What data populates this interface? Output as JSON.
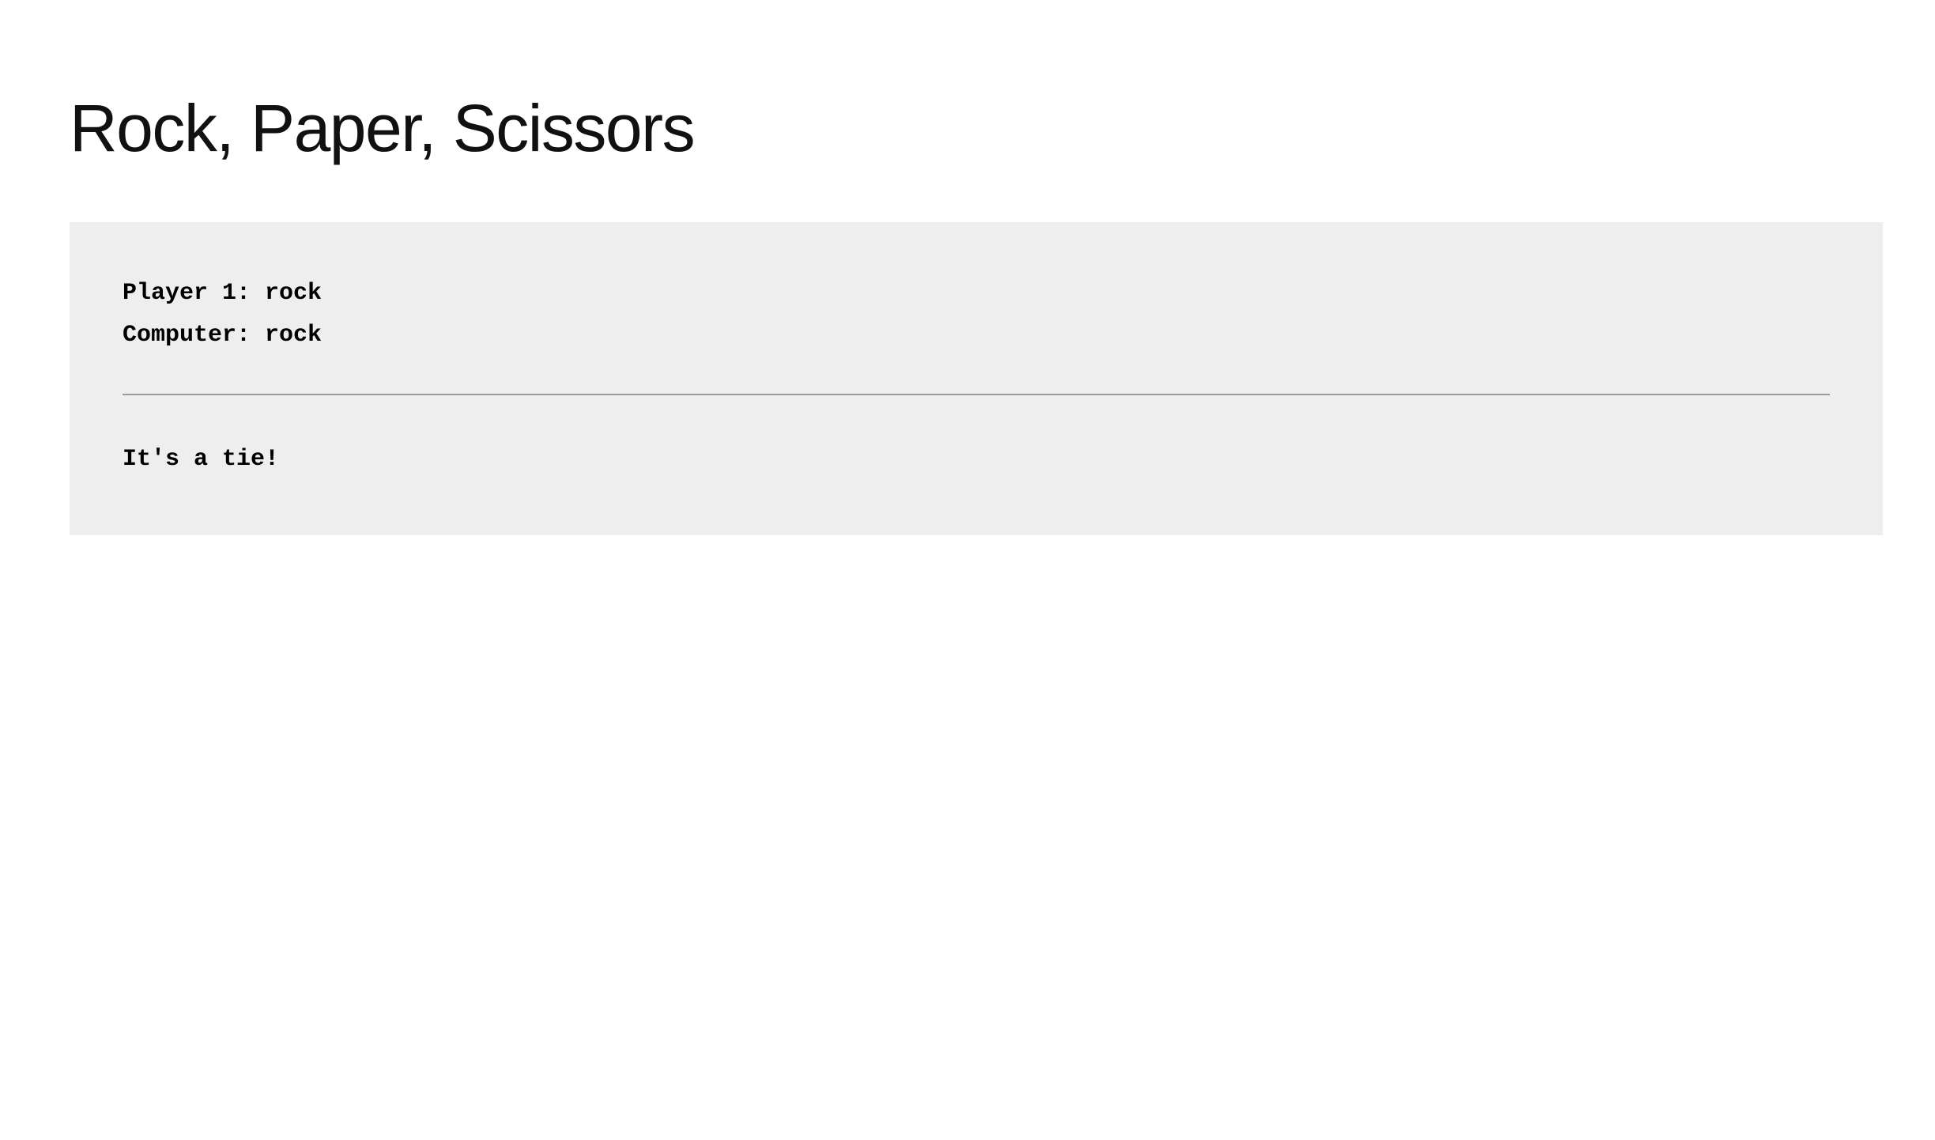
{
  "page": {
    "title": "Rock, Paper, Scissors"
  },
  "result": {
    "player_line": "Player 1: rock",
    "computer_line": "Computer: rock",
    "outcome": "It's a tie!"
  },
  "colors": {
    "panel_background": "#eeeeee",
    "divider": "#9a9a9a",
    "text": "#000000"
  }
}
